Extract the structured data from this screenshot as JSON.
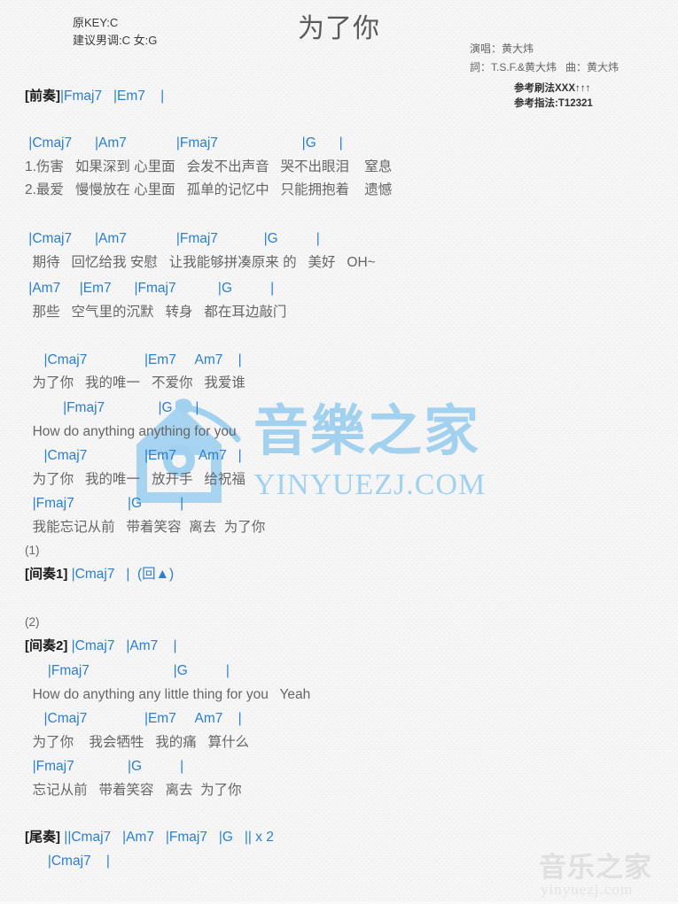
{
  "header": {
    "key_original": "原KEY:C",
    "key_suggest": "建议男调:C 女:G",
    "title": "为了你",
    "singer": "演唱：黄大炜",
    "writers": "詞：T.S.F.&黄大炜   曲：黄大炜",
    "strum": "参考刷法XXX↑↑↑",
    "fingering": "参考指法:T12321"
  },
  "sections": {
    "intro_label": "[前奏]",
    "intro_chords": "|Fmaj7   |Em7    |",
    "verse1": {
      "chords": " |Cmaj7      |Am7             |Fmaj7                      |G      |",
      "lyric1": "1.伤害   如果深到 心里面   会发不出声音   哭不出眼泪    窒息",
      "lyric2": "2.最爱   慢慢放在 心里面   孤单的记忆中   只能拥抱着    遗憾"
    },
    "verse2": {
      "chords": " |Cmaj7      |Am7             |Fmaj7            |G          |",
      "lyric": "  期待   回忆给我 安慰   让我能够拼凑原来 的   美好   OH~",
      "chords_b": " |Am7     |Em7      |Fmaj7           |G          |",
      "lyric_b": "  那些   空气里的沉默   转身   都在耳边敲门"
    },
    "chorus1": {
      "line1_chords": "     |Cmaj7               |Em7     Am7    |",
      "line1_lyric": "  为了你   我的唯一   不爱你   我爱谁",
      "line2_chords": "          |Fmaj7              |G      |",
      "line2_lyric": "  How do anything anything for you",
      "line3_chords": "     |Cmaj7               |Em7      Am7   |",
      "line3_lyric": "  为了你   我的唯一   放开手   给祝福",
      "line4_chords": "  |Fmaj7              |G          |",
      "line4_lyric": "  我能忘记从前   带着笑容  离去  为了你"
    },
    "mark1": "(1)",
    "interlude1_label": "[间奏1]",
    "interlude1_chords": " |Cmaj7   |  (回▲)",
    "mark2": "(2)",
    "interlude2_label": "[间奏2]",
    "interlude2_chords": " |Cmaj7   |Am7    |",
    "interlude2_line2_chords": "      |Fmaj7                      |G          |",
    "interlude2_line2_lyric": "  How do anything any little thing for you   Yeah",
    "chorus2": {
      "line1_chords": "     |Cmaj7               |Em7     Am7    |",
      "line1_lyric": "  为了你    我会牺牲   我的痛   算什么",
      "line2_chords": "  |Fmaj7              |G          |",
      "line2_lyric": "  忘记从前   带着笑容   离去  为了你"
    },
    "outro_label": "[尾奏]",
    "outro_chords": " ||Cmaj7   |Am7   |Fmaj7   |G   || x 2",
    "outro_chords_b": "      |Cmaj7    |"
  },
  "watermark": {
    "center_cn": "音樂之家",
    "center_domain": "YINYUEZJ.COM",
    "corner_cn": "音乐之家",
    "corner_domain": "yinyuezj.com",
    "center_color": "#8ec9ef",
    "corner_color": "#cfcfcf"
  },
  "colors": {
    "chord_blue": "#2a7fd0",
    "lyric_gray": "#666666",
    "label_black": "#1a1a1a",
    "page_bg": "#f8f8f8"
  }
}
